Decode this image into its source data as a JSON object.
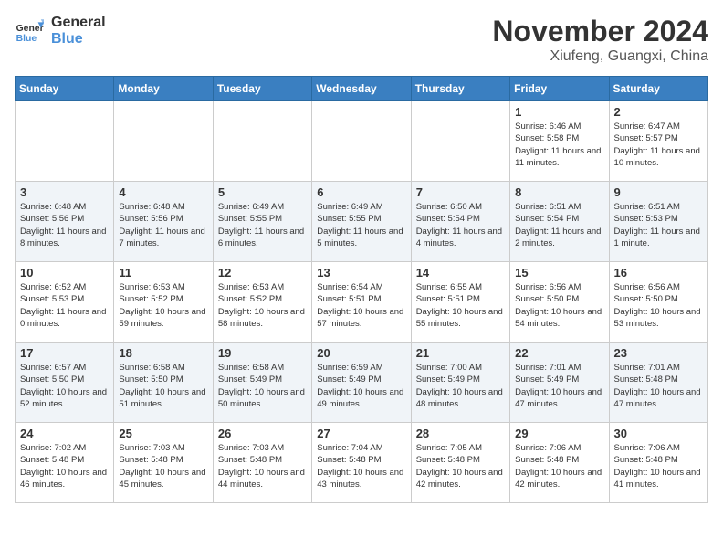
{
  "logo": {
    "line1": "General",
    "line2": "Blue"
  },
  "title": "November 2024",
  "location": "Xiufeng, Guangxi, China",
  "weekdays": [
    "Sunday",
    "Monday",
    "Tuesday",
    "Wednesday",
    "Thursday",
    "Friday",
    "Saturday"
  ],
  "weeks": [
    [
      {
        "day": "",
        "info": ""
      },
      {
        "day": "",
        "info": ""
      },
      {
        "day": "",
        "info": ""
      },
      {
        "day": "",
        "info": ""
      },
      {
        "day": "",
        "info": ""
      },
      {
        "day": "1",
        "info": "Sunrise: 6:46 AM\nSunset: 5:58 PM\nDaylight: 11 hours and 11 minutes."
      },
      {
        "day": "2",
        "info": "Sunrise: 6:47 AM\nSunset: 5:57 PM\nDaylight: 11 hours and 10 minutes."
      }
    ],
    [
      {
        "day": "3",
        "info": "Sunrise: 6:48 AM\nSunset: 5:56 PM\nDaylight: 11 hours and 8 minutes."
      },
      {
        "day": "4",
        "info": "Sunrise: 6:48 AM\nSunset: 5:56 PM\nDaylight: 11 hours and 7 minutes."
      },
      {
        "day": "5",
        "info": "Sunrise: 6:49 AM\nSunset: 5:55 PM\nDaylight: 11 hours and 6 minutes."
      },
      {
        "day": "6",
        "info": "Sunrise: 6:49 AM\nSunset: 5:55 PM\nDaylight: 11 hours and 5 minutes."
      },
      {
        "day": "7",
        "info": "Sunrise: 6:50 AM\nSunset: 5:54 PM\nDaylight: 11 hours and 4 minutes."
      },
      {
        "day": "8",
        "info": "Sunrise: 6:51 AM\nSunset: 5:54 PM\nDaylight: 11 hours and 2 minutes."
      },
      {
        "day": "9",
        "info": "Sunrise: 6:51 AM\nSunset: 5:53 PM\nDaylight: 11 hours and 1 minute."
      }
    ],
    [
      {
        "day": "10",
        "info": "Sunrise: 6:52 AM\nSunset: 5:53 PM\nDaylight: 11 hours and 0 minutes."
      },
      {
        "day": "11",
        "info": "Sunrise: 6:53 AM\nSunset: 5:52 PM\nDaylight: 10 hours and 59 minutes."
      },
      {
        "day": "12",
        "info": "Sunrise: 6:53 AM\nSunset: 5:52 PM\nDaylight: 10 hours and 58 minutes."
      },
      {
        "day": "13",
        "info": "Sunrise: 6:54 AM\nSunset: 5:51 PM\nDaylight: 10 hours and 57 minutes."
      },
      {
        "day": "14",
        "info": "Sunrise: 6:55 AM\nSunset: 5:51 PM\nDaylight: 10 hours and 55 minutes."
      },
      {
        "day": "15",
        "info": "Sunrise: 6:56 AM\nSunset: 5:50 PM\nDaylight: 10 hours and 54 minutes."
      },
      {
        "day": "16",
        "info": "Sunrise: 6:56 AM\nSunset: 5:50 PM\nDaylight: 10 hours and 53 minutes."
      }
    ],
    [
      {
        "day": "17",
        "info": "Sunrise: 6:57 AM\nSunset: 5:50 PM\nDaylight: 10 hours and 52 minutes."
      },
      {
        "day": "18",
        "info": "Sunrise: 6:58 AM\nSunset: 5:50 PM\nDaylight: 10 hours and 51 minutes."
      },
      {
        "day": "19",
        "info": "Sunrise: 6:58 AM\nSunset: 5:49 PM\nDaylight: 10 hours and 50 minutes."
      },
      {
        "day": "20",
        "info": "Sunrise: 6:59 AM\nSunset: 5:49 PM\nDaylight: 10 hours and 49 minutes."
      },
      {
        "day": "21",
        "info": "Sunrise: 7:00 AM\nSunset: 5:49 PM\nDaylight: 10 hours and 48 minutes."
      },
      {
        "day": "22",
        "info": "Sunrise: 7:01 AM\nSunset: 5:49 PM\nDaylight: 10 hours and 47 minutes."
      },
      {
        "day": "23",
        "info": "Sunrise: 7:01 AM\nSunset: 5:48 PM\nDaylight: 10 hours and 47 minutes."
      }
    ],
    [
      {
        "day": "24",
        "info": "Sunrise: 7:02 AM\nSunset: 5:48 PM\nDaylight: 10 hours and 46 minutes."
      },
      {
        "day": "25",
        "info": "Sunrise: 7:03 AM\nSunset: 5:48 PM\nDaylight: 10 hours and 45 minutes."
      },
      {
        "day": "26",
        "info": "Sunrise: 7:03 AM\nSunset: 5:48 PM\nDaylight: 10 hours and 44 minutes."
      },
      {
        "day": "27",
        "info": "Sunrise: 7:04 AM\nSunset: 5:48 PM\nDaylight: 10 hours and 43 minutes."
      },
      {
        "day": "28",
        "info": "Sunrise: 7:05 AM\nSunset: 5:48 PM\nDaylight: 10 hours and 42 minutes."
      },
      {
        "day": "29",
        "info": "Sunrise: 7:06 AM\nSunset: 5:48 PM\nDaylight: 10 hours and 42 minutes."
      },
      {
        "day": "30",
        "info": "Sunrise: 7:06 AM\nSunset: 5:48 PM\nDaylight: 10 hours and 41 minutes."
      }
    ]
  ]
}
